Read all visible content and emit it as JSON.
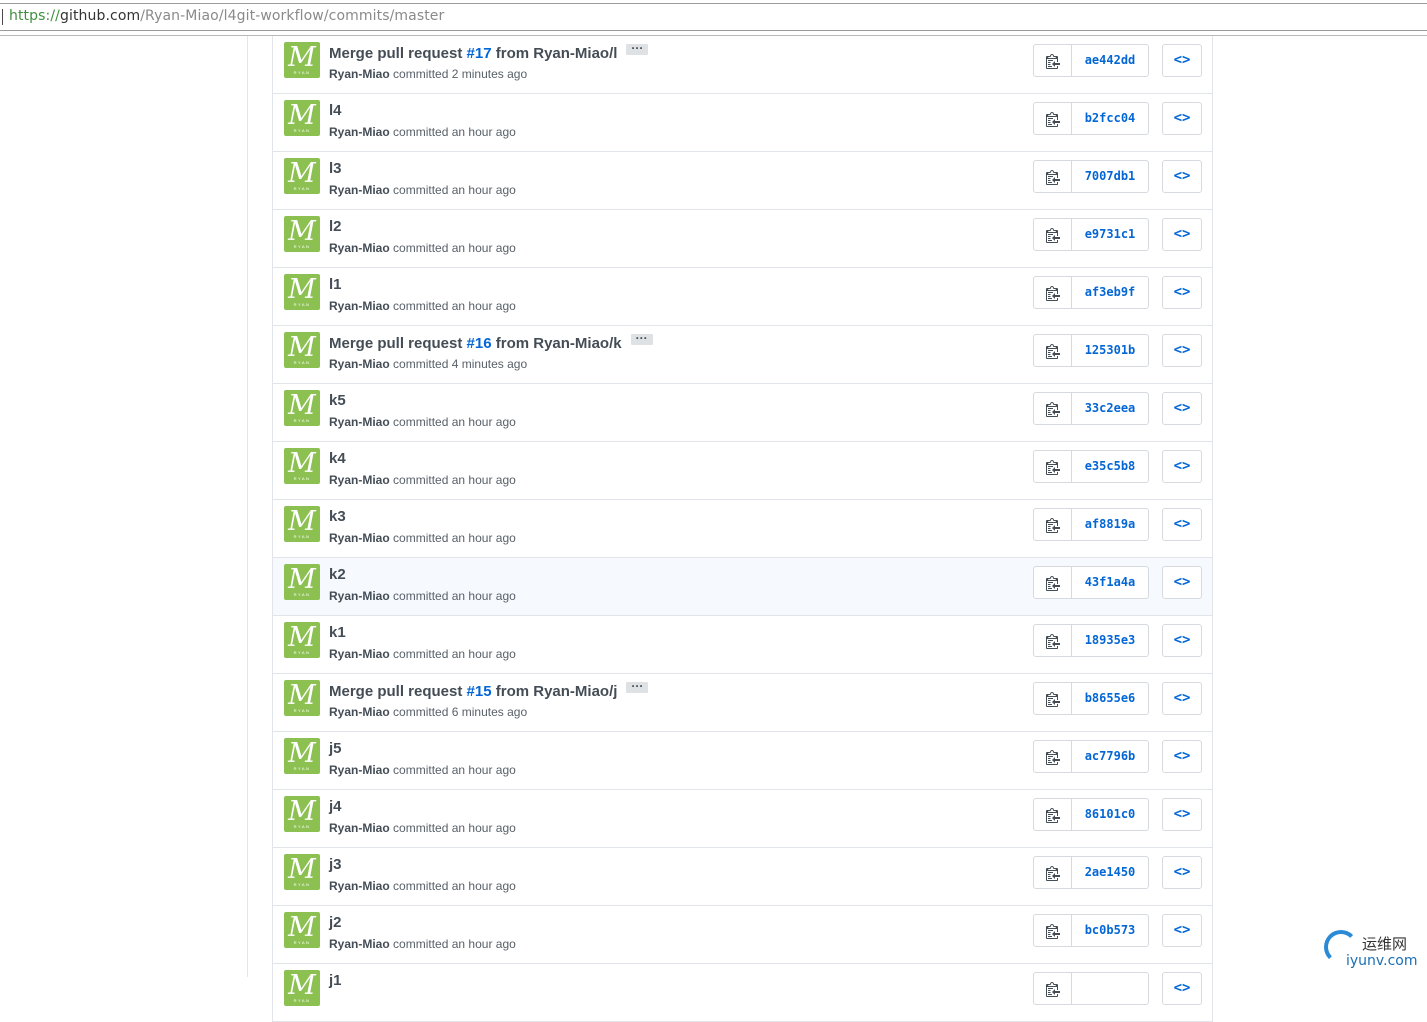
{
  "browser": {
    "url_protocol": "https://",
    "url_host": "github.com",
    "url_path": "/Ryan-Miao/l4git-workflow/commits/master"
  },
  "avatar": {
    "letter": "M",
    "sub": "RYAN",
    "color": "#8cc152"
  },
  "verb": "committed",
  "commits": [
    {
      "title_pre": "Merge pull request ",
      "issue": "#17",
      "title_post": " from Ryan-Miao/l",
      "expand": "···",
      "author": "Ryan-Miao",
      "time": "2 minutes ago",
      "sha": "ae442dd"
    },
    {
      "title_pre": "l4",
      "issue": "",
      "title_post": "",
      "expand": "",
      "author": "Ryan-Miao",
      "time": "an hour ago",
      "sha": "b2fcc04"
    },
    {
      "title_pre": "l3",
      "issue": "",
      "title_post": "",
      "expand": "",
      "author": "Ryan-Miao",
      "time": "an hour ago",
      "sha": "7007db1"
    },
    {
      "title_pre": "l2",
      "issue": "",
      "title_post": "",
      "expand": "",
      "author": "Ryan-Miao",
      "time": "an hour ago",
      "sha": "e9731c1"
    },
    {
      "title_pre": "l1",
      "issue": "",
      "title_post": "",
      "expand": "",
      "author": "Ryan-Miao",
      "time": "an hour ago",
      "sha": "af3eb9f"
    },
    {
      "title_pre": "Merge pull request ",
      "issue": "#16",
      "title_post": " from Ryan-Miao/k",
      "expand": "···",
      "author": "Ryan-Miao",
      "time": "4 minutes ago",
      "sha": "125301b"
    },
    {
      "title_pre": "k5",
      "issue": "",
      "title_post": "",
      "expand": "",
      "author": "Ryan-Miao",
      "time": "an hour ago",
      "sha": "33c2eea"
    },
    {
      "title_pre": "k4",
      "issue": "",
      "title_post": "",
      "expand": "",
      "author": "Ryan-Miao",
      "time": "an hour ago",
      "sha": "e35c5b8"
    },
    {
      "title_pre": "k3",
      "issue": "",
      "title_post": "",
      "expand": "",
      "author": "Ryan-Miao",
      "time": "an hour ago",
      "sha": "af8819a"
    },
    {
      "title_pre": "k2",
      "issue": "",
      "title_post": "",
      "expand": "",
      "author": "Ryan-Miao",
      "time": "an hour ago",
      "sha": "43f1a4a",
      "highlighted": true
    },
    {
      "title_pre": "k1",
      "issue": "",
      "title_post": "",
      "expand": "",
      "author": "Ryan-Miao",
      "time": "an hour ago",
      "sha": "18935e3"
    },
    {
      "title_pre": "Merge pull request ",
      "issue": "#15",
      "title_post": " from Ryan-Miao/j",
      "expand": "···",
      "author": "Ryan-Miao",
      "time": "6 minutes ago",
      "sha": "b8655e6"
    },
    {
      "title_pre": "j5",
      "issue": "",
      "title_post": "",
      "expand": "",
      "author": "Ryan-Miao",
      "time": "an hour ago",
      "sha": "ac7796b"
    },
    {
      "title_pre": "j4",
      "issue": "",
      "title_post": "",
      "expand": "",
      "author": "Ryan-Miao",
      "time": "an hour ago",
      "sha": "86101c0"
    },
    {
      "title_pre": "j3",
      "issue": "",
      "title_post": "",
      "expand": "",
      "author": "Ryan-Miao",
      "time": "an hour ago",
      "sha": "2ae1450"
    },
    {
      "title_pre": "j2",
      "issue": "",
      "title_post": "",
      "expand": "",
      "author": "Ryan-Miao",
      "time": "an hour ago",
      "sha": "bc0b573"
    },
    {
      "title_pre": "j1",
      "issue": "",
      "title_post": "",
      "expand": "",
      "author": "",
      "time": "",
      "sha": ""
    }
  ],
  "browse_label": "<>",
  "watermark": {
    "cn": "运维网",
    "en": "iyunv.com"
  }
}
